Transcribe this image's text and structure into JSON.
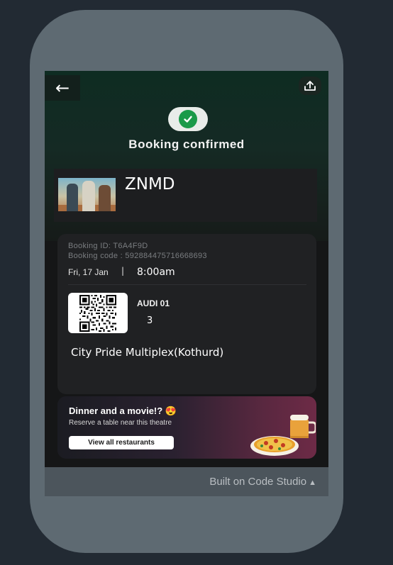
{
  "header": {
    "back_glyph": "←",
    "title": "Booking confirmed"
  },
  "movie": {
    "title": "ZNMD"
  },
  "ticket": {
    "booking_id": "Booking ID: T6A4F9D",
    "booking_code": "Booking code : 592884475716668693",
    "date": "Fri, 17 Jan",
    "separator": "|",
    "time": "8:00am",
    "audi": "AUDI 01",
    "seat": "3",
    "theatre": "City Pride Multiplex(Kothurd)"
  },
  "promo": {
    "title": "Dinner and a movie!?",
    "emoji": "😍",
    "subtitle": "Reserve a table near this theatre",
    "button_label": "View all restaurants"
  },
  "footer": {
    "text": "Built on Code Studio",
    "caret": "▲"
  },
  "icons": {
    "back": "back-arrow-icon",
    "share": "share-upload-icon",
    "check": "check-icon",
    "qr": "qr-code-icon",
    "beer": "beer-mug-icon",
    "pizza": "pizza-icon"
  },
  "colors": {
    "success_green": "#1a9a49",
    "promo_accent": "#6d2a46",
    "screen_bg": "#151617",
    "phone_frame": "#5e6a72"
  }
}
